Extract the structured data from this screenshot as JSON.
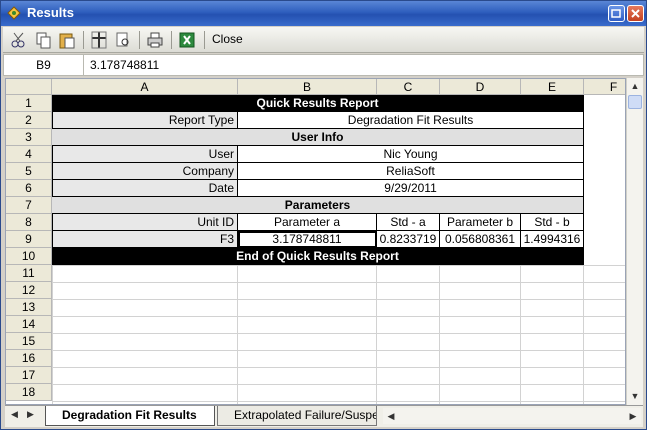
{
  "window": {
    "title": "Results"
  },
  "toolbar": {
    "close_label": "Close"
  },
  "formula_bar": {
    "cell_ref": "B9",
    "value": "3.178748811"
  },
  "columns": [
    "A",
    "B",
    "C",
    "D",
    "E",
    "F"
  ],
  "rows": [
    "1",
    "2",
    "3",
    "4",
    "5",
    "6",
    "7",
    "8",
    "9",
    "10",
    "11",
    "12",
    "13",
    "14",
    "15",
    "16",
    "17",
    "18"
  ],
  "report": {
    "header": "Quick Results Report",
    "report_type_label": "Report Type",
    "report_type_value": "Degradation Fit Results",
    "user_info_header": "User Info",
    "user_label": "User",
    "user_value": "Nic Young",
    "company_label": "Company",
    "company_value": "ReliaSoft",
    "date_label": "Date",
    "date_value": "9/29/2011",
    "parameters_header": "Parameters",
    "param_headers": [
      "Unit ID",
      "Parameter a",
      "Std - a",
      "Parameter b",
      "Std - b"
    ],
    "param_values": [
      "F3",
      "3.178748811",
      "0.8233719",
      "0.056808361",
      "1.4994316"
    ],
    "footer": "End of Quick Results Report"
  },
  "sheet_tabs": [
    "Degradation Fit Results",
    "Extrapolated Failure/Susper"
  ],
  "colors": {
    "titlebar": "#2e5ebd",
    "header_black": "#000000",
    "section_grey": "#e0e0e0"
  }
}
